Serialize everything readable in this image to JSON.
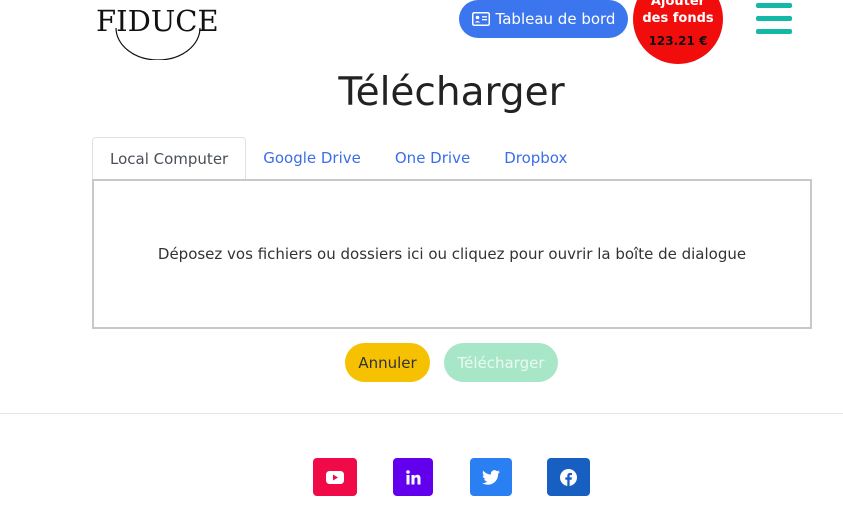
{
  "header": {
    "logo_text": "FIDUCE",
    "dashboard_label": "Tableau de bord",
    "funds": {
      "line1": "Ajouter",
      "line2": "des fonds",
      "amount": "123.21 €"
    },
    "colors": {
      "dashboard": "#3b76ef",
      "funds": "#f20d0d",
      "menu": "#14b8a6"
    }
  },
  "main": {
    "title": "Télécharger",
    "tabs": [
      {
        "label": "Local Computer",
        "active": true
      },
      {
        "label": "Google Drive",
        "active": false
      },
      {
        "label": "One Drive",
        "active": false
      },
      {
        "label": "Dropbox",
        "active": false
      }
    ],
    "dropzone_text": "Déposez vos fichiers ou dossiers ici ou cliquez pour ouvrir la boîte de dialogue",
    "cancel_label": "Annuler",
    "upload_label": "Télécharger"
  },
  "footer": {
    "social": [
      {
        "icon": "youtube-icon",
        "color": "#f00a47"
      },
      {
        "icon": "linkedin-icon",
        "color": "#6200ee"
      },
      {
        "icon": "twitter-icon",
        "color": "#2a7ff2"
      },
      {
        "icon": "facebook-icon",
        "color": "#175fc0"
      }
    ]
  }
}
